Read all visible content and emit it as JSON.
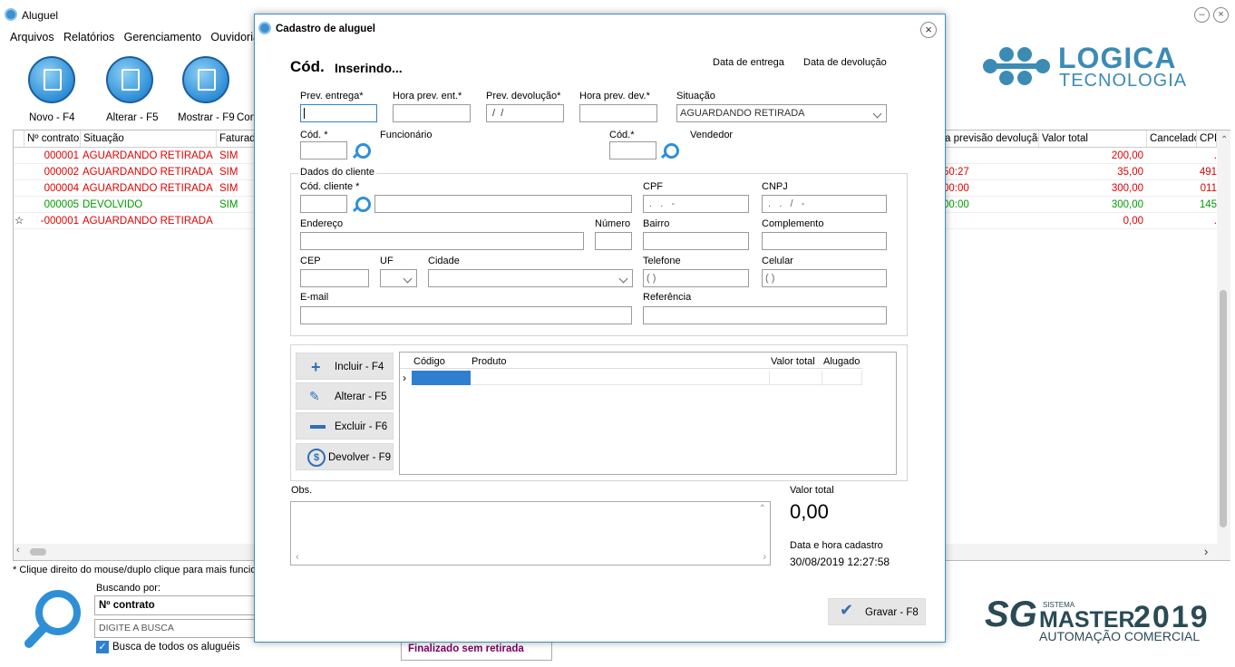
{
  "window": {
    "title": "Aluguel"
  },
  "menu": [
    "Arquivos",
    "Relatórios",
    "Gerenciamento",
    "Ouvidoria"
  ],
  "toolbar": {
    "novo": "Novo - F4",
    "alterar": "Alterar - F5",
    "mostrar": "Mostrar - F9",
    "con": "Con"
  },
  "grid": {
    "headers": {
      "contrato": "Nº contrato",
      "situacao": "Situação",
      "faturado": "Faturad",
      "prev_devolucao": "a previsão devolução",
      "valor_total": "Valor total",
      "cancelado": "Cancelado",
      "cpf": "CPF"
    },
    "rows": [
      {
        "contrato": "000001",
        "situacao": "AGUARDANDO RETIRADA",
        "faturado": "SIM",
        "prev": "",
        "valor": "200,00",
        "cpf": ".",
        "color": "red"
      },
      {
        "contrato": "000002",
        "situacao": "AGUARDANDO RETIRADA",
        "faturado": "SIM",
        "prev": "50:27",
        "valor": "35,00",
        "cpf": "491",
        "color": "red"
      },
      {
        "contrato": "000004",
        "situacao": "AGUARDANDO RETIRADA",
        "faturado": "SIM",
        "prev": "00:00",
        "valor": "300,00",
        "cpf": "011",
        "color": "red"
      },
      {
        "contrato": "000005",
        "situacao": "DEVOLVIDO",
        "faturado": "SIM",
        "prev": "00:00",
        "valor": "300,00",
        "cpf": "145",
        "color": "green"
      },
      {
        "contrato": "-000001",
        "situacao": "AGUARDANDO RETIRADA",
        "faturado": "",
        "prev": "",
        "valor": "0,00",
        "cpf": ".",
        "color": "red"
      }
    ]
  },
  "footer": {
    "hint": "* Clique direito do mouse/duplo clique para mais funcion",
    "buscando_label": "Buscando por:",
    "buscando_value": "Nº contrato",
    "search_placeholder": "DIGITE A BUSCA",
    "checkbox_label": "Busca de todos os aluguéis",
    "status_button": "Finalizado sem retirada"
  },
  "branding": {
    "logica_1": "LOGICA",
    "logica_2": "TECNOLOGIA",
    "sg": "SG",
    "sistema": "SISTEMA",
    "master": "MASTER",
    "year": "2019",
    "automacao": "AUTOMAÇÃO COMERCIAL"
  },
  "dialog": {
    "title": "Cadastro de aluguel",
    "cod_label": "Cód.",
    "cod_value": "Inserindo...",
    "data_entrega": "Data de entrega",
    "data_devolucao": "Data de devolução",
    "prev_entrega": "Prev. entrega*",
    "hora_prev_ent": "Hora prev. ent.*",
    "prev_devolucao": "Prev. devolução*",
    "hora_prev_dev": "Hora prev. dev.*",
    "situacao": "Situação",
    "situacao_value": "AGUARDANDO RETIRADA",
    "prev_devolucao_value": " /  /",
    "cod_func": "Cód. *",
    "funcionario": "Funcionário",
    "cod_vend": "Cód.*",
    "vendedor": "Vendedor",
    "dados_cliente": "Dados do cliente",
    "cod_cliente": "Cód. cliente *",
    "cpf": "CPF",
    "cpf_mask": " .   .   -",
    "cnpj": "CNPJ",
    "cnpj_mask": " .   .   /   -",
    "endereco": "Endereço",
    "numero": "Número",
    "bairro": "Bairro",
    "complemento": "Complemento",
    "cep": "CEP",
    "uf": "UF",
    "cidade": "Cidade",
    "telefone": "Telefone",
    "telefone_mask": "( )",
    "celular": "Celular",
    "celular_mask": "( )",
    "email": "E-mail",
    "referencia": "Referência",
    "btn_incluir": "Incluir - F4",
    "btn_alterar": "Alterar - F5",
    "btn_excluir": "Excluir - F6",
    "btn_devolver": "Devolver - F9",
    "items_headers": {
      "codigo": "Código",
      "produto": "Produto",
      "valor_total": "Valor total",
      "alugado": "Alugado"
    },
    "obs": "Obs.",
    "valor_total_label": "Valor total",
    "valor_total_value": "0,00",
    "data_hora_label": "Data e hora cadastro",
    "data_hora_value": "30/08/2019 12:27:58",
    "gravar": "Gravar - F8"
  }
}
